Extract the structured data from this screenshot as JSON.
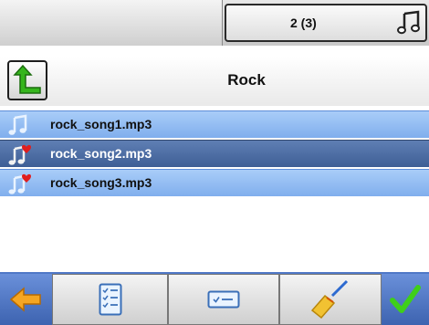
{
  "header": {
    "counter": "2 (3)"
  },
  "folder": {
    "title": "Rock"
  },
  "songs": [
    {
      "name": "rock_song1.mp3",
      "icon": "music-note-icon",
      "selected": false
    },
    {
      "name": "rock_song2.mp3",
      "icon": "favorite-music-icon",
      "selected": true
    },
    {
      "name": "rock_song3.mp3",
      "icon": "favorite-music-icon",
      "selected": false
    }
  ],
  "toolbar": {
    "back_icon": "back-arrow-icon",
    "select_all_icon": "checklist-icon",
    "select_icon": "select-box-icon",
    "clear_icon": "broom-icon",
    "ok_icon": "checkmark-icon"
  },
  "colors": {
    "row": "#99c1f4",
    "row_selected": "#4f6fa5",
    "accent_green": "#38b000",
    "toolbar_blue": "#4f78c7"
  }
}
